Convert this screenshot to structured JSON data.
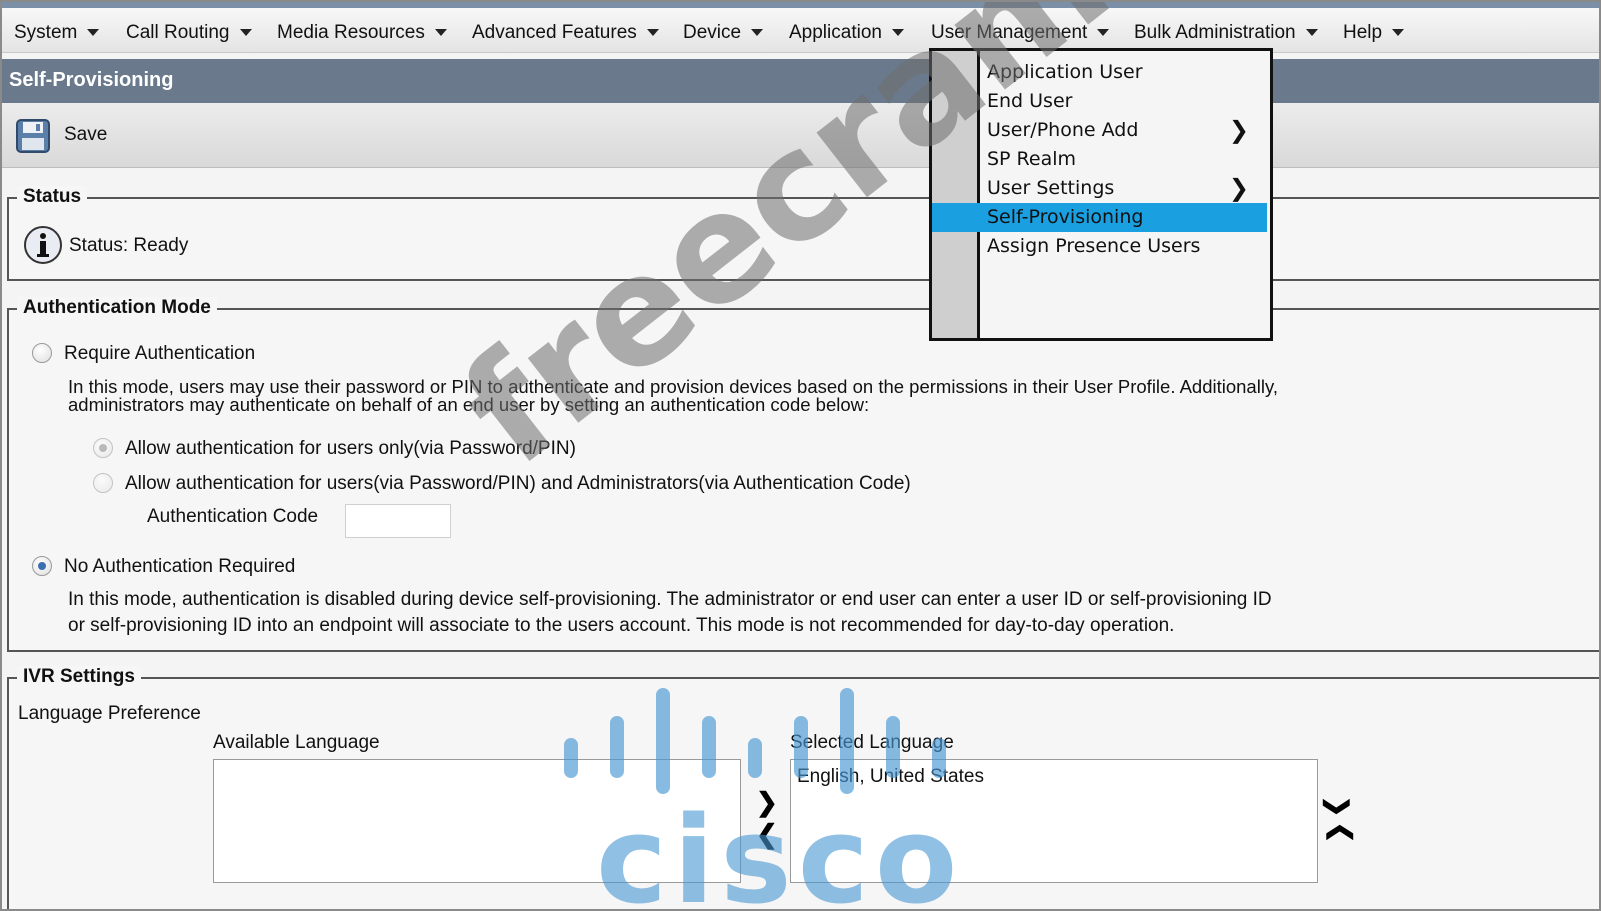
{
  "menubar": {
    "items": [
      "System",
      "Call Routing",
      "Media Resources",
      "Advanced Features",
      "Device",
      "Application",
      "User Management",
      "Bulk Administration",
      "Help"
    ]
  },
  "page": {
    "title": "Self-Provisioning",
    "save_label": "Save"
  },
  "status": {
    "legend": "Status",
    "text": "Status: Ready"
  },
  "auth": {
    "legend": "Authentication Mode",
    "require_label": "Require Authentication",
    "require_desc_line1": "In this mode, users may use their password or PIN to authenticate and provision devices based on the permissions in their User Profile. Additionally,",
    "require_desc_line2": "administrators may authenticate on behalf of an end user by setting an authentication code below:",
    "option_users_only": "Allow authentication for users only(via Password/PIN)",
    "option_users_admins": "Allow authentication for users(via Password/PIN) and Administrators(via Authentication Code)",
    "auth_code_label": "Authentication Code",
    "auth_code_value": "",
    "none_label": "No Authentication Required",
    "none_desc_line1": "In this mode, authentication is disabled during device self-provisioning. The administrator or end user can enter a user ID or self-provisioning ID",
    "none_desc_line2": "or self-provisioning ID into an endpoint will associate to the users account. This mode is not recommended for day-to-day operation.",
    "selected_mode": "No Authentication Required"
  },
  "ivr": {
    "legend": "IVR Settings",
    "language_pref": "Language Preference",
    "available_label": "Available Language",
    "available_items": [],
    "selected_label": "Selected Language",
    "selected_items": [
      "English, United States"
    ]
  },
  "dropdown": {
    "items": [
      {
        "label": "Application User",
        "submenu": false
      },
      {
        "label": "End User",
        "submenu": false
      },
      {
        "label": "User/Phone Add",
        "submenu": true
      },
      {
        "label": "SP Realm",
        "submenu": false
      },
      {
        "label": "User Settings",
        "submenu": true
      },
      {
        "label": "Self-Provisioning",
        "submenu": false,
        "active": true
      },
      {
        "label": "Assign Presence Users",
        "submenu": false
      }
    ]
  },
  "watermark": "freecram.net",
  "logo": "cisco"
}
